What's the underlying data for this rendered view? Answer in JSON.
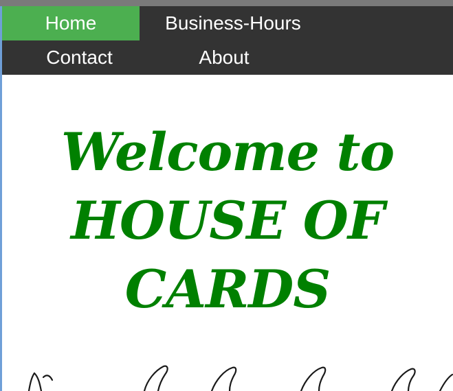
{
  "nav": {
    "items": [
      {
        "label": "Home",
        "active": true
      },
      {
        "label": "Business-Hours",
        "active": false
      },
      {
        "label": "Contact",
        "active": false
      },
      {
        "label": "About",
        "active": false
      }
    ],
    "active_color": "#4caf50",
    "bar_color": "#333333"
  },
  "hero": {
    "line1": "Welcome to",
    "line2": "HOUSE OF",
    "line3": "CARDS",
    "color": "#008000"
  }
}
